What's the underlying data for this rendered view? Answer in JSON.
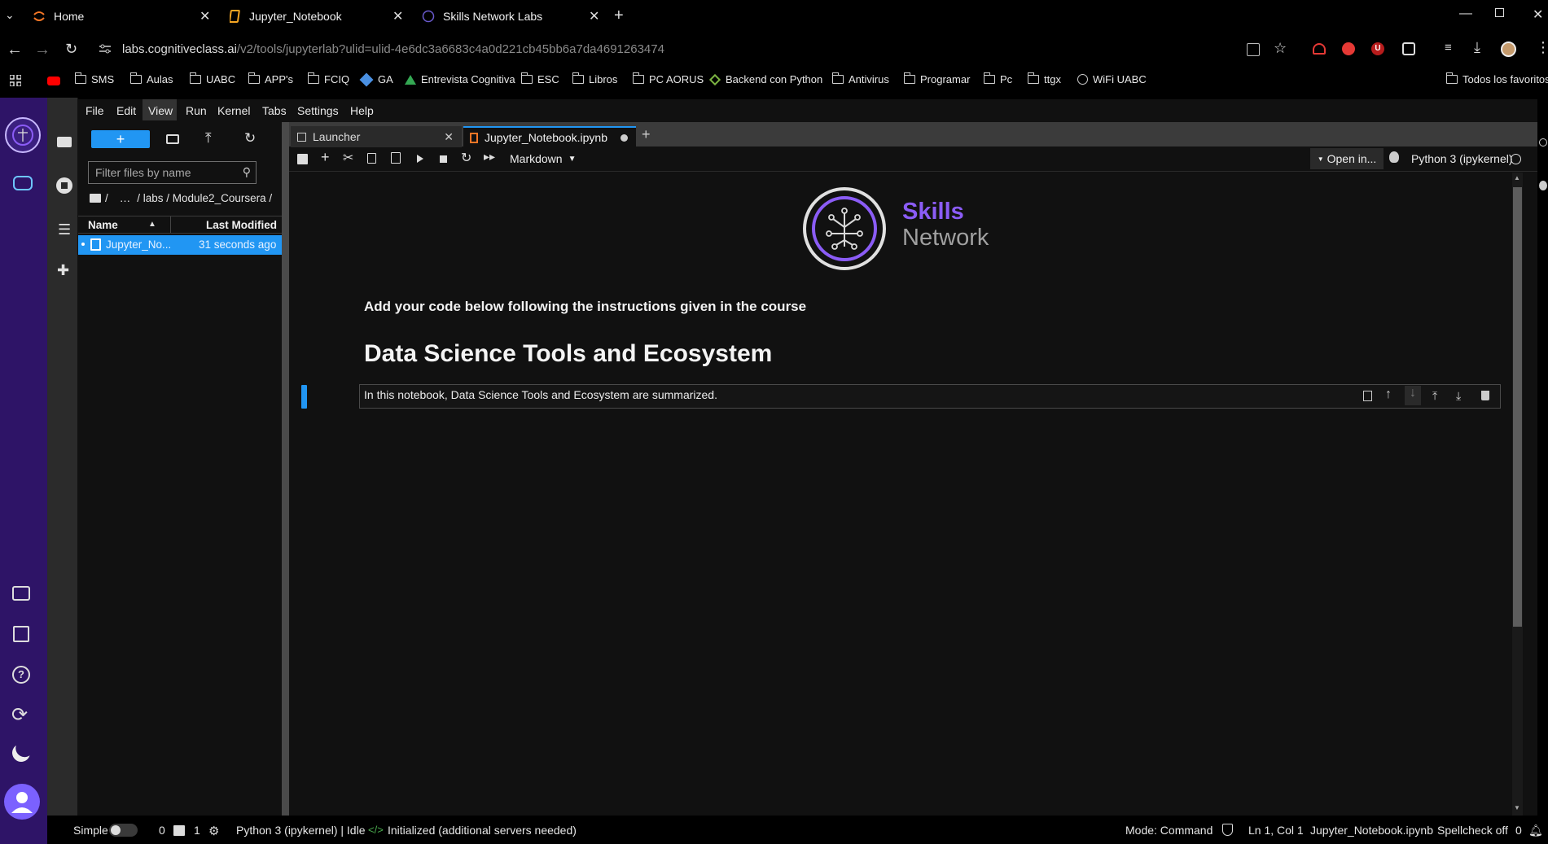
{
  "browser": {
    "tabs": [
      {
        "title": "Home"
      },
      {
        "title": "Jupyter_Notebook"
      },
      {
        "title": "Skills Network Labs"
      }
    ],
    "url_host": "labs.cognitiveclass.ai",
    "url_path": "/v2/tools/jupyterlab?ulid=ulid-4e6dc3a6683c4a0d221cb45bb6a7da4691263474",
    "bookmarks": [
      "SMS",
      "Aulas",
      "UABC",
      "APP's",
      "FCIQ",
      "GA",
      "Entrevista Cognitiva",
      "ESC",
      "Libros",
      "PC AORUS",
      "Backend con Python",
      "Antivirus",
      "Programar",
      "Pc",
      "ttgx",
      "WiFi UABC"
    ],
    "all_bookmarks": "Todos los favoritos"
  },
  "menu": {
    "items": [
      "File",
      "Edit",
      "View",
      "Run",
      "Kernel",
      "Tabs",
      "Settings",
      "Help"
    ]
  },
  "filebrowser": {
    "new_label": "+",
    "filter_placeholder": "Filter files by name",
    "breadcrumb_root": "/",
    "breadcrumb_ellipsis": "…",
    "breadcrumb_path": "/ labs / Module2_Coursera /",
    "col_name": "Name",
    "col_modified": "Last Modified",
    "files": [
      {
        "name": "Jupyter_No...",
        "modified": "31 seconds ago"
      }
    ]
  },
  "dock": {
    "tabs": [
      {
        "label": "Launcher"
      },
      {
        "label": "Jupyter_Notebook.ipynb"
      }
    ],
    "add": "+"
  },
  "toolbar": {
    "cell_type": "Markdown",
    "open_in": "Open in...",
    "kernel": "Python 3 (ipykernel)"
  },
  "notebook": {
    "logo_word1": "Skills",
    "logo_word2": "Network",
    "instructions": "Add your code below following the instructions given in the course",
    "heading": "Data Science Tools and Ecosystem",
    "active_cell_text": "In this notebook, Data Science Tools and Ecosystem are summarized."
  },
  "status": {
    "mode_label": "Simple",
    "count_a": "0",
    "count_b": "1",
    "kernel_status": "Python 3 (ipykernel) | Idle",
    "lsp": "Initialized (additional servers needed)",
    "mode": "Mode: Command",
    "cursor": "Ln 1, Col 1",
    "file": "Jupyter_Notebook.ipynb",
    "spellcheck": "Spellcheck off",
    "notifications": "0"
  },
  "colors": {
    "accent": "#2196f3",
    "brand": "#2e1467",
    "logo": "#8b5cf6"
  }
}
